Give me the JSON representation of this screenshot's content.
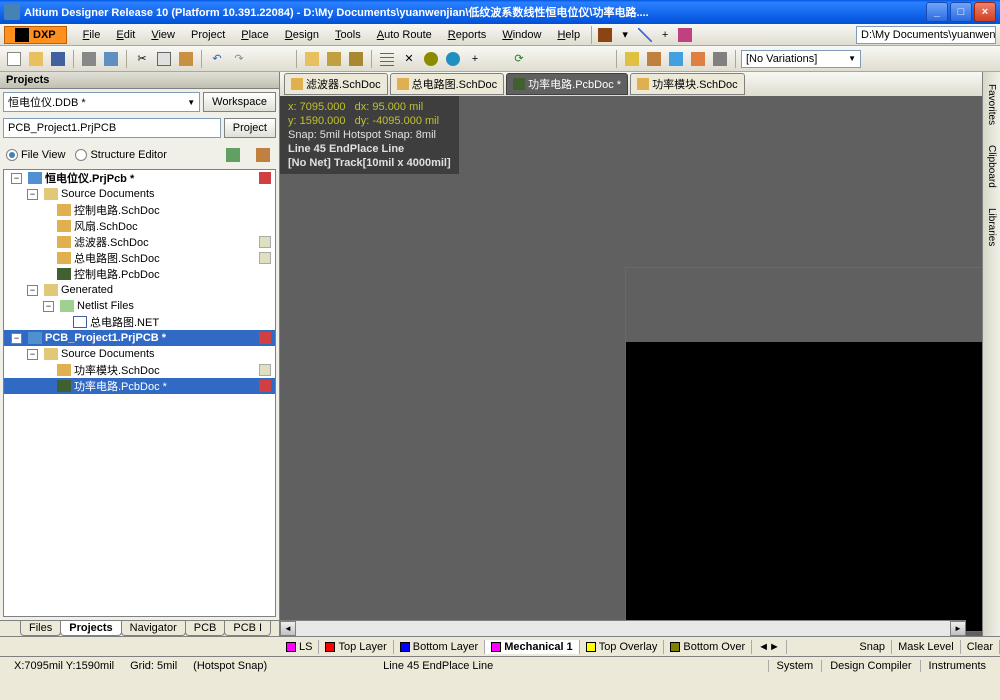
{
  "titlebar": {
    "text": "Altium Designer Release 10 (Platform 10.391.22084) - D:\\My Documents\\yuanwenjian\\低纹波系数线性恒电位仪\\功率电路...."
  },
  "menu": {
    "dxp": "DXP",
    "items": [
      "File",
      "Edit",
      "View",
      "Project",
      "Place",
      "Design",
      "Tools",
      "Auto Route",
      "Reports",
      "Window",
      "Help"
    ]
  },
  "path_field": "D:\\My Documents\\yuanwenji",
  "novariations": "[No Variations]",
  "panel": {
    "title": "Projects",
    "workspace_combo": "恒电位仪.DDB *",
    "workspace_btn": "Workspace",
    "project_combo": "PCB_Project1.PrjPCB",
    "project_btn": "Project",
    "radio_file": "File View",
    "radio_struct": "Structure Editor"
  },
  "tree": {
    "n0": "恒电位仪.PrjPcb *",
    "n1": "Source Documents",
    "n2": "控制电路.SchDoc",
    "n3": "风扇.SchDoc",
    "n4": "滤波器.SchDoc",
    "n5": "总电路图.SchDoc",
    "n6": "控制电路.PcbDoc",
    "n7": "Generated",
    "n8": "Netlist Files",
    "n9": "总电路图.NET",
    "n10": "PCB_Project1.PrjPCB *",
    "n11": "Source Documents",
    "n12": "功率模块.SchDoc",
    "n13": "功率电路.PcbDoc *"
  },
  "bottom_tabs": [
    "Files",
    "Projects",
    "Navigator",
    "PCB",
    "PCB I"
  ],
  "doc_tabs": [
    {
      "label": "滤波器.SchDoc"
    },
    {
      "label": "总电路图.SchDoc"
    },
    {
      "label": "功率电路.PcbDoc *"
    },
    {
      "label": "功率模块.SchDoc"
    }
  ],
  "hud": {
    "l1a": "x: 7095.000",
    "l1b": "dx:   95.000  mil",
    "l2a": "y: 1590.000",
    "l2b": "dy: -4095.000 mil",
    "l3": "Snap: 5mil Hotspot Snap: 8mil",
    "l4": "Line 45 EndPlace Line",
    "l5": "[No Net] Track[10mil x 4000mil]"
  },
  "layers": {
    "ls": "LS",
    "top": "Top Layer",
    "bottom": "Bottom Layer",
    "mech": "Mechanical 1",
    "topov": "Top Overlay",
    "botov": "Bottom Over",
    "snap": "Snap",
    "mask": "Mask Level",
    "clear": "Clear"
  },
  "right_tabs": [
    "Favorites",
    "Clipboard",
    "Libraries"
  ],
  "status": {
    "coords": "X:7095mil Y:1590mil",
    "grid": "Grid: 5mil",
    "hotspot": "(Hotspot Snap)",
    "msg": "Line 45 EndPlace Line",
    "btns": [
      "System",
      "Design Compiler",
      "Instruments"
    ]
  }
}
